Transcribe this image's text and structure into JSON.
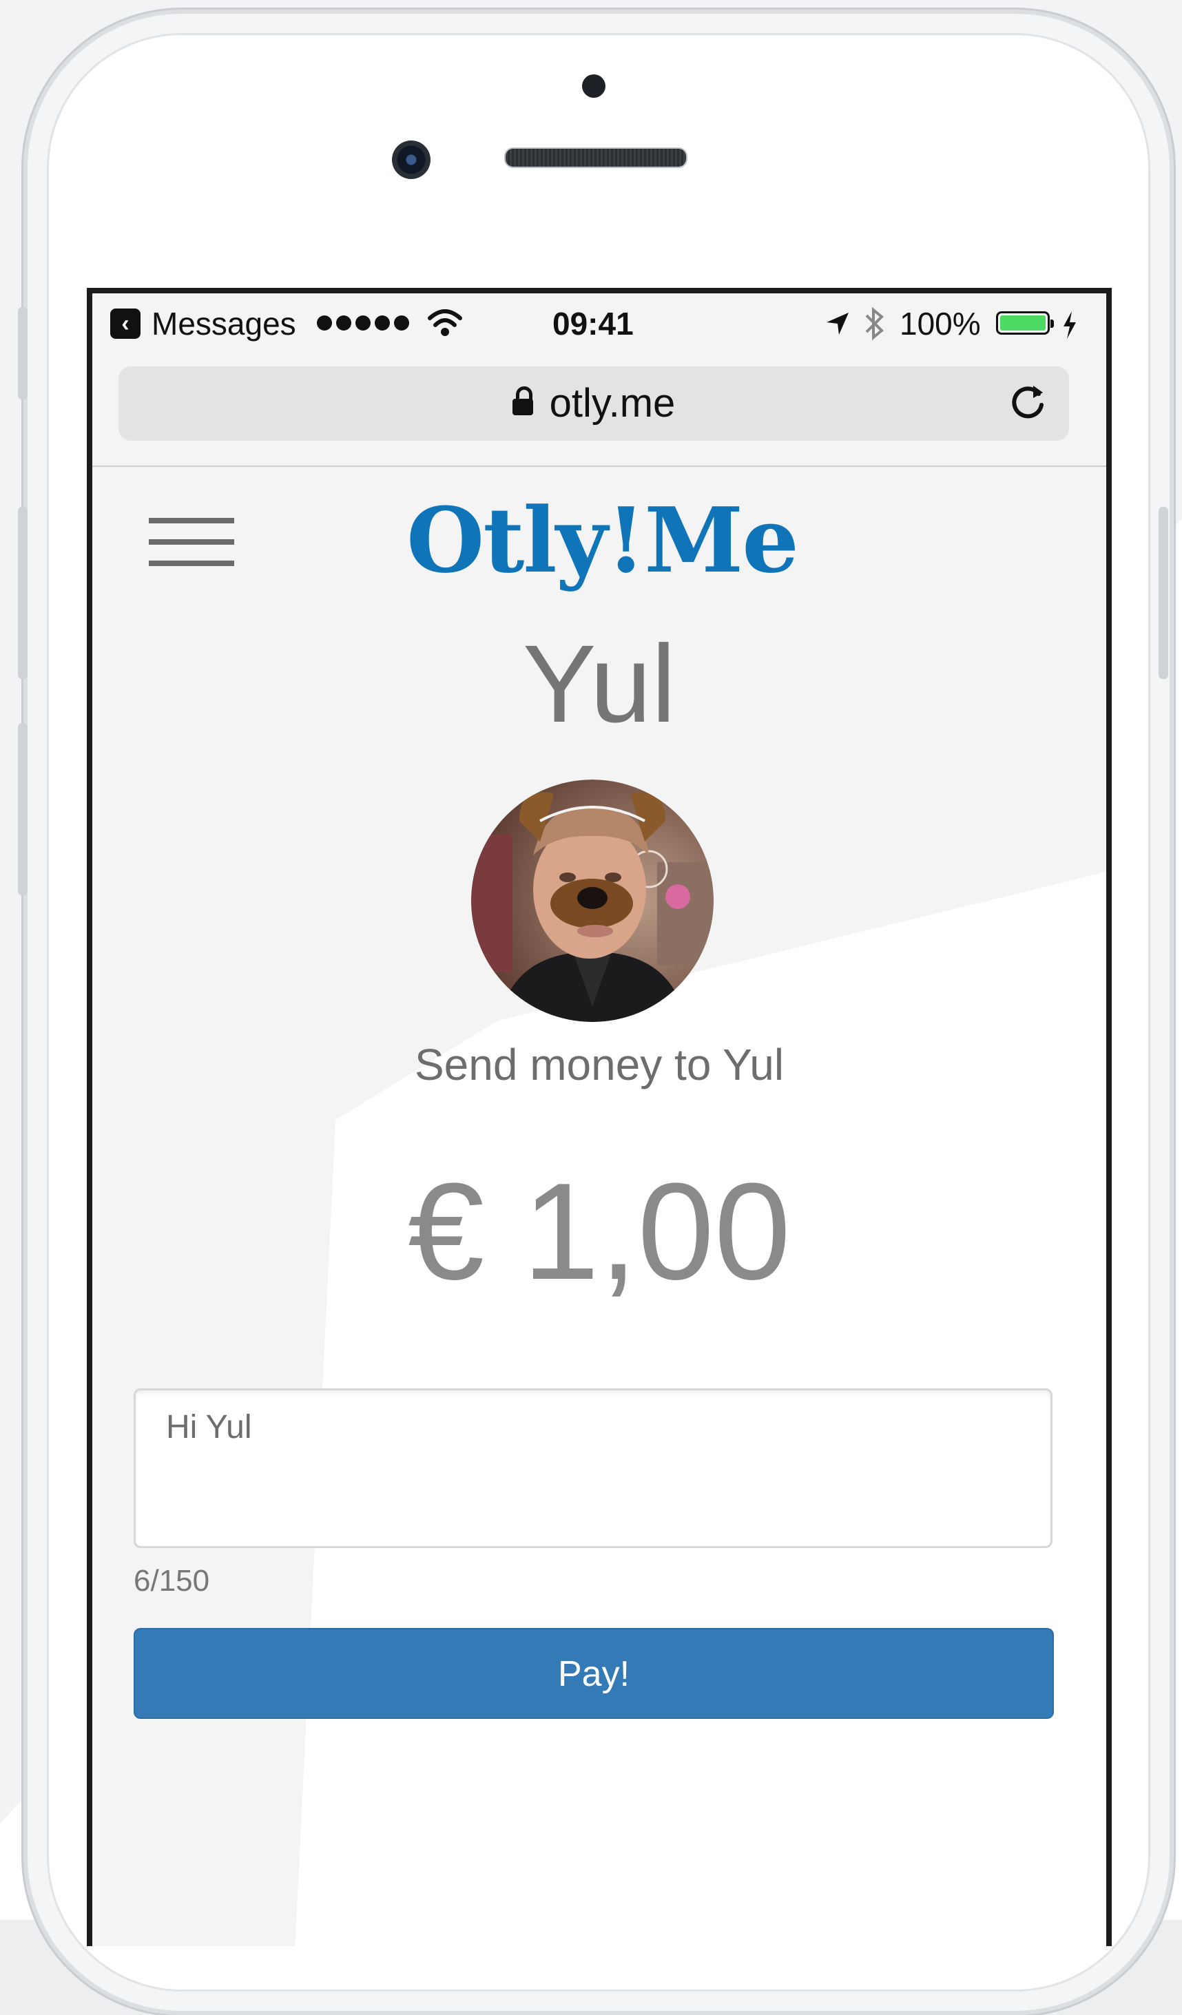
{
  "status_bar": {
    "back_app": "Messages",
    "time": "09:41",
    "battery_percent": "100%",
    "battery_level": 1.0,
    "battery_color": "#4cd964",
    "icons": [
      "back-arrow-icon",
      "signal-dots-icon",
      "wifi-icon",
      "location-arrow-icon",
      "bluetooth-icon",
      "battery-icon",
      "charging-bolt-icon"
    ]
  },
  "browser": {
    "url": "otly.me",
    "lock_icon": "lock-icon",
    "reload_icon": "reload-icon"
  },
  "header": {
    "menu_icon": "hamburger-menu-icon",
    "logo_text": "Otly!Me",
    "logo_color": "#0f75b8"
  },
  "profile": {
    "name": "Yul",
    "avatar": "profile-photo",
    "send_label": "Send money to Yul"
  },
  "payment": {
    "amount": "€ 1,00",
    "message": "Hi Yul",
    "char_counter": "6/150",
    "pay_label": "Pay!",
    "pay_color": "#337ab7"
  }
}
